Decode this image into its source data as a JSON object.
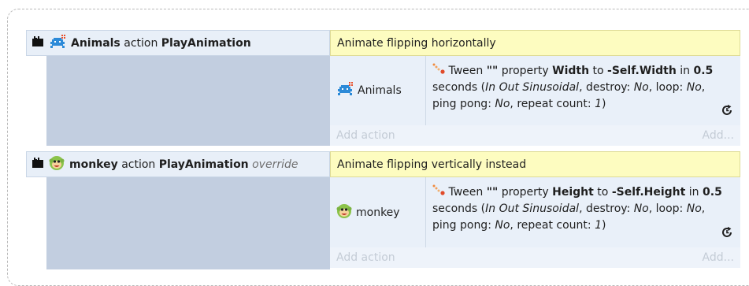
{
  "events": [
    {
      "object_name": "Animals",
      "action_word": "action",
      "animation_name": "PlayAnimation",
      "override_label": "",
      "comment": "Animate flipping horizontally",
      "action_object": "Animals",
      "tween": {
        "prefix": "Tween",
        "id": "\"\"",
        "property_word": "property",
        "property": "Width",
        "to_word": "to",
        "target": "-Self.Width",
        "in_word": "in",
        "duration": "0.5",
        "seconds_word": "seconds (",
        "easing": "In Out Sinusoidal",
        "destroy_text": ", destroy: ",
        "destroy": "No",
        "loop_text": ", loop: ",
        "loop": "No",
        "pingpong_text": ", ping pong: ",
        "pingpong": "No",
        "repeat_text": ", repeat count: ",
        "repeat": "1",
        "close": ")"
      },
      "add_action": "Add action",
      "add_more": "Add..."
    },
    {
      "object_name": "monkey",
      "action_word": "action",
      "animation_name": "PlayAnimation",
      "override_label": "override",
      "comment": "Animate flipping vertically instead",
      "action_object": "monkey",
      "tween": {
        "prefix": "Tween",
        "id": "\"\"",
        "property_word": "property",
        "property": "Height",
        "to_word": "to",
        "target": "-Self.Height",
        "in_word": "in",
        "duration": "0.5",
        "seconds_word": "seconds (",
        "easing": "In Out Sinusoidal",
        "destroy_text": ", destroy: ",
        "destroy": "No",
        "loop_text": ", loop: ",
        "loop": "No",
        "pingpong_text": ", ping pong: ",
        "pingpong": "No",
        "repeat_text": ", repeat count: ",
        "repeat": "1",
        "close": ")"
      },
      "add_action": "Add action",
      "add_more": "Add..."
    }
  ],
  "icons": {
    "folder": "folder-icon",
    "animals": "space-invader-icon",
    "monkey": "monkey-icon",
    "tween": "tween-icon",
    "repeat": "repeat-icon"
  },
  "colors": {
    "header_left_bg": "#e8eff8",
    "comment_bg": "#fdfcc0",
    "sidebar_gray": "#c2cee0",
    "action_bg": "#e9f0f9",
    "placeholder_text": "#c4ccd6"
  }
}
